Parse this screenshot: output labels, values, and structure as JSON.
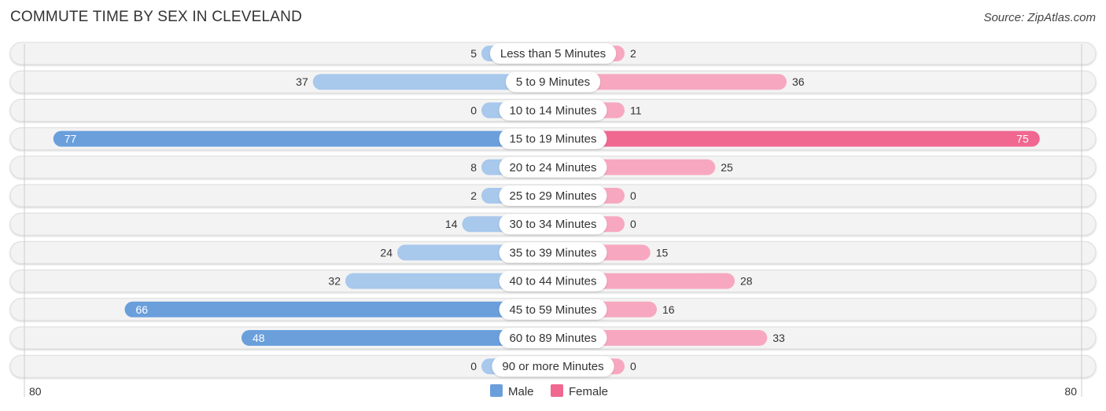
{
  "header": {
    "title": "COMMUTE TIME BY SEX IN CLEVELAND",
    "source": "Source: ZipAtlas.com"
  },
  "chart_data": {
    "type": "bar",
    "orientation": "horizontal-diverging",
    "title": "COMMUTE TIME BY SEX IN CLEVELAND",
    "source": "Source: ZipAtlas.com",
    "categories": [
      "Less than 5 Minutes",
      "5 to 9 Minutes",
      "10 to 14 Minutes",
      "15 to 19 Minutes",
      "20 to 24 Minutes",
      "25 to 29 Minutes",
      "30 to 34 Minutes",
      "35 to 39 Minutes",
      "40 to 44 Minutes",
      "45 to 59 Minutes",
      "60 to 89 Minutes",
      "90 or more Minutes"
    ],
    "series": [
      {
        "name": "Male",
        "color": "#6a9fdc",
        "light_color": "#a8c8ec",
        "values": [
          5,
          37,
          0,
          77,
          8,
          2,
          14,
          24,
          32,
          66,
          48,
          0
        ]
      },
      {
        "name": "Female",
        "color": "#f06790",
        "light_color": "#f7a8c0",
        "values": [
          2,
          36,
          11,
          75,
          25,
          0,
          0,
          15,
          28,
          16,
          33,
          0
        ]
      }
    ],
    "axis": {
      "left_label": "80",
      "right_label": "80",
      "max": 80
    },
    "legend": {
      "position": "bottom-center",
      "items": [
        "Male",
        "Female"
      ]
    }
  }
}
